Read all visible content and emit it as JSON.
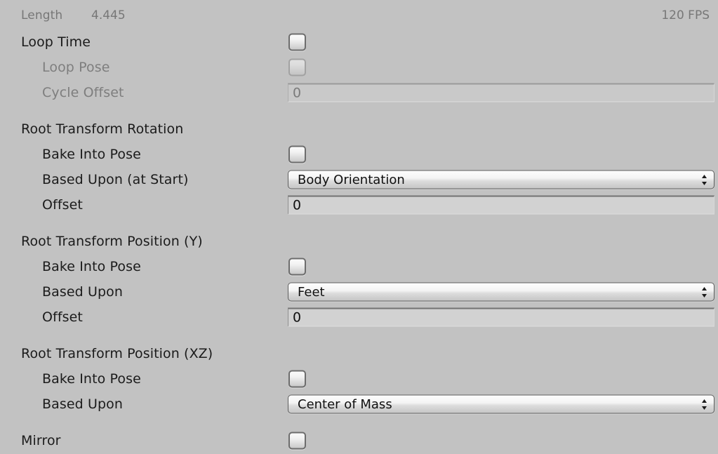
{
  "header": {
    "length_label": "Length",
    "length_value": "4.445",
    "fps": "120 FPS"
  },
  "rows": {
    "loop_time": {
      "label": "Loop Time",
      "checked": false
    },
    "loop_pose": {
      "label": "Loop Pose",
      "checked": false
    },
    "cycle_offset": {
      "label": "Cycle Offset",
      "value": "0"
    },
    "rotation_header": {
      "label": "Root Transform Rotation"
    },
    "rotation_bake": {
      "label": "Bake Into Pose",
      "checked": false
    },
    "rotation_based_upon": {
      "label": "Based Upon (at Start)",
      "value": "Body Orientation"
    },
    "rotation_offset": {
      "label": "Offset",
      "value": "0"
    },
    "position_y_header": {
      "label": "Root Transform Position (Y)"
    },
    "position_y_bake": {
      "label": "Bake Into Pose",
      "checked": false
    },
    "position_y_based_upon": {
      "label": "Based Upon",
      "value": "Feet"
    },
    "position_y_offset": {
      "label": "Offset",
      "value": "0"
    },
    "position_xz_header": {
      "label": "Root Transform Position (XZ)"
    },
    "position_xz_bake": {
      "label": "Bake Into Pose",
      "checked": false
    },
    "position_xz_based_upon": {
      "label": "Based Upon",
      "value": "Center of Mass"
    },
    "mirror": {
      "label": "Mirror",
      "checked": false
    }
  },
  "colors": {
    "background": "#c2c2c2",
    "label_text": "#1b1b1b",
    "disabled_text": "#7e7e7e",
    "muted_text": "#777777",
    "field_background": "#d2d2d2"
  }
}
